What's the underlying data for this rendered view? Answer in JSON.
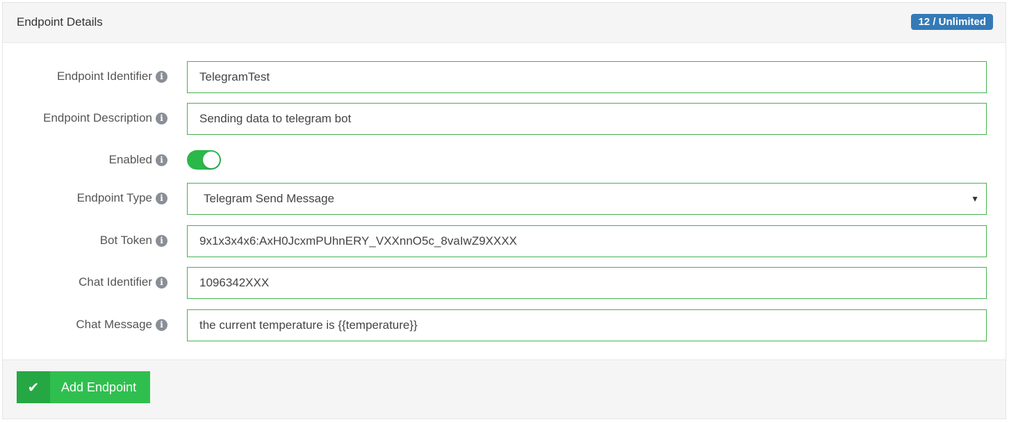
{
  "header": {
    "title": "Endpoint Details",
    "badge": "12 / Unlimited"
  },
  "icons": {
    "info": "info-circle-icon",
    "check": "check-icon",
    "caret": "caret-down-icon"
  },
  "colors": {
    "accent_green": "#2fbf4f",
    "field_border": "#45b24f",
    "badge_blue": "#337ab7",
    "info_gray": "#8a8f96"
  },
  "form": {
    "identifier": {
      "label": "Endpoint Identifier",
      "value": "TelegramTest"
    },
    "description": {
      "label": "Endpoint Description",
      "value": "Sending data to telegram bot"
    },
    "enabled": {
      "label": "Enabled",
      "value": true
    },
    "type": {
      "label": "Endpoint Type",
      "value": "Telegram Send Message"
    },
    "bot_token": {
      "label": "Bot Token",
      "value": "9x1x3x4x6:AxH0JcxmPUhnERY_VXXnnO5c_8vaIwZ9XXXX"
    },
    "chat_id": {
      "label": "Chat Identifier",
      "value": "1096342XXX"
    },
    "chat_message": {
      "label": "Chat Message",
      "value": "the current temperature is {{temperature}}"
    }
  },
  "footer": {
    "add_label": "Add Endpoint"
  }
}
